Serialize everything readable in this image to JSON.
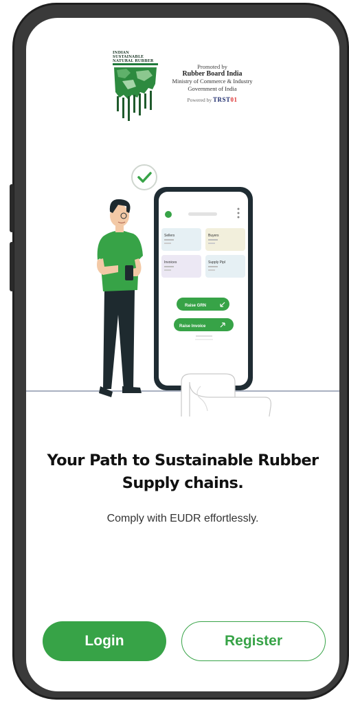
{
  "logo": {
    "line1": "INDIAN SUSTAINABLE",
    "line2": "NATURAL RUBBER",
    "accent": "#1f7a3a"
  },
  "promo": {
    "promoted_by": "Promoted by",
    "org": "Rubber Board India",
    "ministry": "Ministry of Commerce & Industry",
    "government": "Government of India",
    "powered_by": "Powered by",
    "brand_part1": "TRST",
    "brand_part2": "01"
  },
  "illustration": {
    "cards": [
      "Sellers",
      "Buyers",
      "Invoices",
      "Supply Pipl"
    ],
    "raise_grn_label": "Raise GRN",
    "raise_invoice_label": "Raise Invoice"
  },
  "headline": "Your Path to Sustainable Rubber Supply chains.",
  "subline": "Comply with EUDR effortlessly.",
  "buttons": {
    "login": "Login",
    "register": "Register"
  },
  "colors": {
    "accent": "#37a347",
    "text": "#111111"
  }
}
